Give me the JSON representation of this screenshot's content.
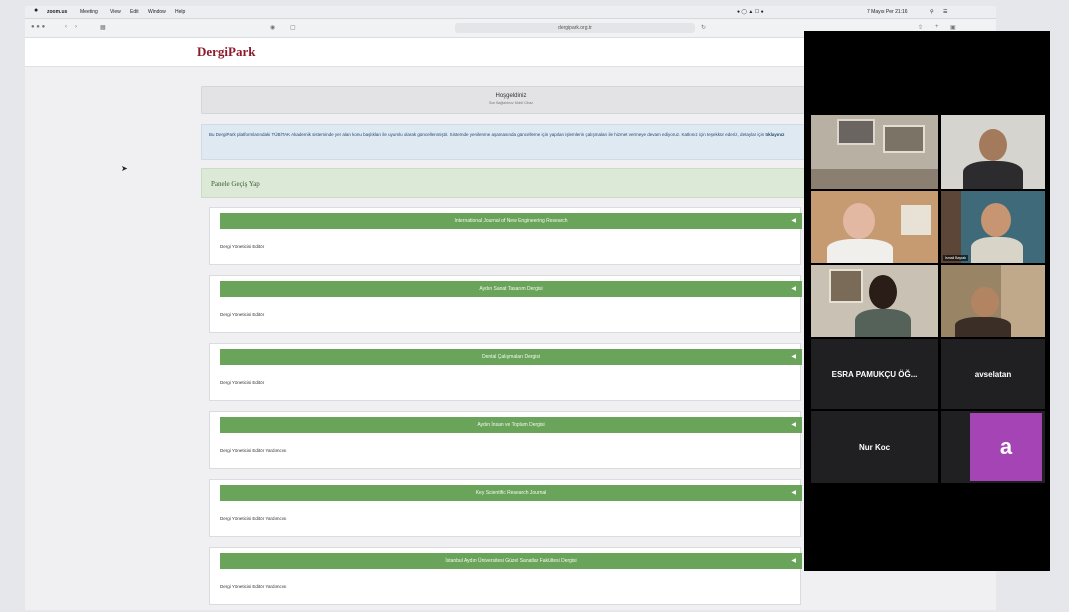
{
  "menubar": {
    "items": [
      "zoom.us",
      "Meeting",
      "View",
      "Edit",
      "Window",
      "Help"
    ],
    "clock": "7 Mayıs Per 21:16"
  },
  "browser": {
    "url": "dergipark.org.tr"
  },
  "site": {
    "logo": "DergiPark",
    "welcome_title": "Hoşgeldiniz",
    "welcome_subtitle": "Son Bağlantınız Mobil Cihaz",
    "info_text": "Bu DergiPark platformlarındaki TÜBİTAK Akademik sisteminde yer alan konu başlıkları ile uyumlu olarak güncellenmiştir. Sistemde yenilenme aşamasında güncelleme için yapılan işlemlerin çalışmaları ile hizmet vermeye devam ediyoruz. Katkınız için teşekkür ederiz, detaylar için",
    "info_link": "tıklayınız",
    "switch_label": "Panele Geçiş Yap"
  },
  "journals": [
    {
      "name": "International Journal of New Engineering Research",
      "role": "Dergi Yöneticisi Editör"
    },
    {
      "name": "Aydın Sanat Tasarım Dergisi",
      "role": "Dergi Yöneticisi Editör"
    },
    {
      "name": "Dental Çalışmaları Dergisi",
      "role": "Dergi Yöneticisi Editör"
    },
    {
      "name": "Aydın İnsan ve Toplum Dergisi",
      "role": "Dergi Yöneticisi Editör Yardımcısı"
    },
    {
      "name": "Key Scientific Research Journal",
      "role": "Dergi Yöneticisi Editör Yardımcısı"
    },
    {
      "name": "İstanbul Aydın Üniversitesi Güzel Sanatlar Fakültesi Dergisi",
      "role": "Dergi Yöneticisi Editör Yardımcısı"
    }
  ],
  "zoom": {
    "participant_names": {
      "p4": "İsmail Bayrak",
      "esra": "ESRA PAMUKÇU ÖĞ...",
      "user2": "avselatan",
      "nur": "Nur Koc",
      "avatar_letter": "a"
    }
  },
  "colors": {
    "accent_green": "#6aa45a",
    "logo_red": "#8b1a2a",
    "avatar_purple": "#a544b5"
  }
}
